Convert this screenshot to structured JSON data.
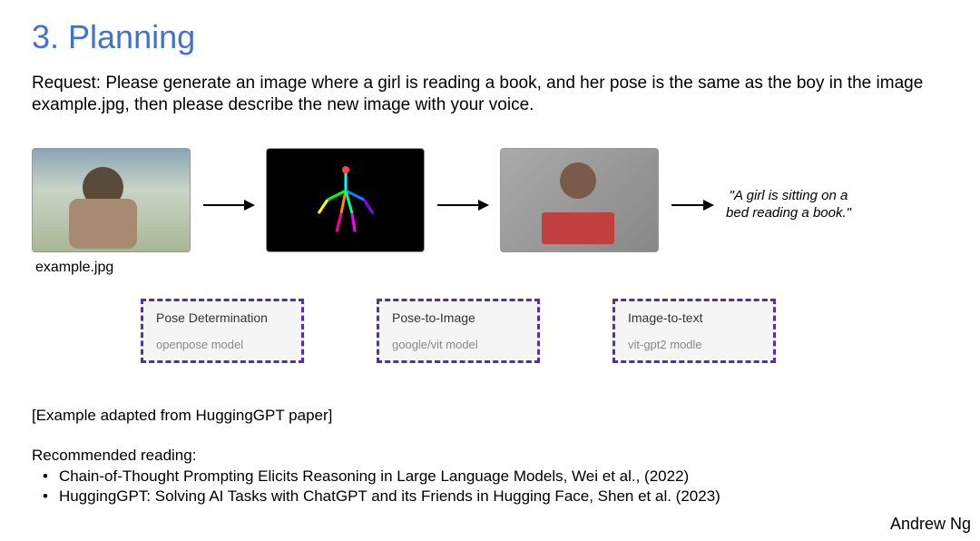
{
  "slide": {
    "title": "3. Planning",
    "request": "Request: Please generate an image where a girl is reading a book, and her pose is the same as the boy in the image example.jpg, then please describe the new image with your voice.",
    "example_label": "example.jpg",
    "output_caption": "\"A girl is sitting on a bed reading a book.\""
  },
  "tools": [
    {
      "title": "Pose Determination",
      "model": "openpose model"
    },
    {
      "title": "Pose-to-Image",
      "model": "google/vit model"
    },
    {
      "title": "Image-to-text",
      "model": "vit-gpt2 modle"
    }
  ],
  "source_note": "[Example adapted from HuggingGPT paper]",
  "recommended": {
    "heading": "Recommended reading:",
    "items": [
      "Chain-of-Thought Prompting Elicits Reasoning in Large Language Models, Wei et al., (2022)",
      "HuggingGPT: Solving AI Tasks with ChatGPT and its Friends in Hugging Face, Shen et al. (2023)"
    ]
  },
  "author": "Andrew Ng"
}
